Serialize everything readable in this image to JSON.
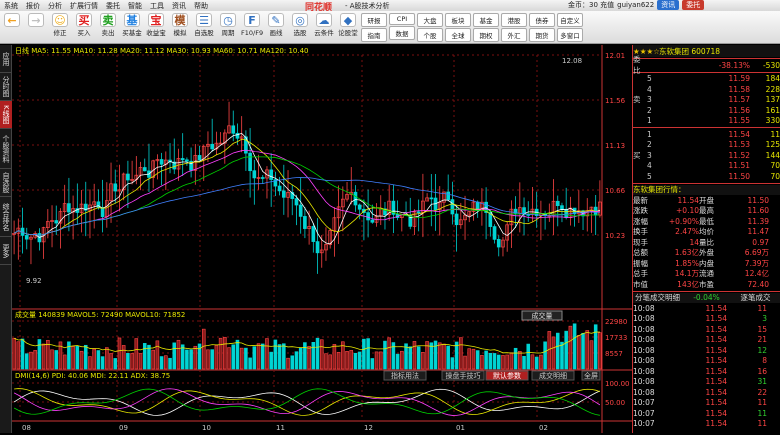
{
  "titlebar": {
    "menus": [
      "系统",
      "报价",
      "分析",
      "扩展行情",
      "委托",
      "智能",
      "工具",
      "资讯",
      "帮助"
    ],
    "logo": "同花顺",
    "title": "- A股技术分析",
    "account": "金币：30 充值",
    "user": "guiyan622",
    "btn1": "资讯",
    "btn2": "委托"
  },
  "toolbar": {
    "items": [
      {
        "label": "",
        "icon": "←",
        "color": "#f0a020"
      },
      {
        "label": "",
        "icon": "→",
        "color": "#c0c0c0"
      },
      {
        "label": "修正",
        "icon": "☺",
        "color": "#f0b020"
      },
      {
        "label": "买入",
        "icon": "买",
        "color": "#e02020"
      },
      {
        "label": "卖出",
        "icon": "卖",
        "color": "#20a020"
      },
      {
        "label": "买基金",
        "icon": "基",
        "color": "#2080e0"
      },
      {
        "label": "收益宝",
        "icon": "宝",
        "color": "#e02020"
      },
      {
        "label": "模拟",
        "icon": "模",
        "color": "#a05020"
      },
      {
        "label": "自选股",
        "icon": "☰",
        "color": "#3070c0"
      },
      {
        "label": "周期",
        "icon": "◷",
        "color": "#3070c0"
      },
      {
        "label": "F10/F9",
        "icon": "F",
        "color": "#3070c0"
      },
      {
        "label": "画线",
        "icon": "✎",
        "color": "#3070c0"
      },
      {
        "label": "选股",
        "icon": "◎",
        "color": "#3070c0"
      },
      {
        "label": "云条件",
        "icon": "☁",
        "color": "#3070c0"
      },
      {
        "label": "论股堂",
        "icon": "◆",
        "color": "#3070c0"
      }
    ],
    "pairs": [
      [
        "研报",
        "指南"
      ],
      [
        "CPI",
        "数据"
      ],
      [
        "大盘",
        "个股"
      ],
      [
        "板块",
        "全球"
      ],
      [
        "基金",
        "期权"
      ],
      [
        "港股",
        "外汇"
      ],
      [
        "债券",
        "期货"
      ],
      [
        "自定义",
        "多窗口"
      ]
    ]
  },
  "leftbar": {
    "tabs": [
      "应用",
      "分时图",
      "K线图",
      "个股资料",
      "自选股",
      "综合排名",
      "更多"
    ],
    "active": 2
  },
  "chart": {
    "header": "日线  MA5: 11.55  MA10: 11.28  MA20: 11.12  MA30: 10.93  MA60: 10.71  MA120: 10.40",
    "price_ticks": [
      "12.01",
      "11.56",
      "11.13",
      "10.66",
      "10.23"
    ],
    "high_label": "12.08",
    "low_label": "9.92",
    "vol_header": "成交量 140839  MAVOL5: 72490  MAVOL10: 71852",
    "vol_ticks": [
      "22980",
      "17733",
      "8557"
    ],
    "vol_button": "成交量",
    "ind_header": "DMI(14,6) PDI: 40.06  MDI: 22.11  ADX: 38.75",
    "ind_tabs": [
      "指标用法",
      "操盘手技巧",
      "默认参数",
      "成交明细",
      "全屏"
    ],
    "ind_tab_active": 2,
    "ind_ticks": [
      "100.00",
      "50.00"
    ],
    "dates": [
      "08",
      "09",
      "10",
      "11",
      "12",
      "01",
      "02"
    ]
  },
  "quote": {
    "title": "东软集团 600718",
    "ratio_label": "委比",
    "ratio": "-38.13%",
    "ratio_diff": "-530",
    "sell_label": "卖",
    "buy_label": "买",
    "sells": [
      [
        "5",
        "11.59",
        "184"
      ],
      [
        "4",
        "11.58",
        "228"
      ],
      [
        "3",
        "11.57",
        "137"
      ],
      [
        "2",
        "11.56",
        "161"
      ],
      [
        "1",
        "11.55",
        "330"
      ]
    ],
    "buys": [
      [
        "1",
        "11.54",
        "11"
      ],
      [
        "2",
        "11.53",
        "125"
      ],
      [
        "3",
        "11.52",
        "144"
      ],
      [
        "4",
        "11.51",
        "70"
      ],
      [
        "5",
        "11.50",
        "70"
      ]
    ],
    "info_title": "东软集团行情：",
    "info": [
      [
        "最新",
        "11.54",
        "开盘",
        "11.50"
      ],
      [
        "涨跌",
        "+0.10",
        "最高",
        "11.60"
      ],
      [
        "涨幅",
        "+0.90%",
        "最低",
        "11.39"
      ],
      [
        "换手",
        "2.47%",
        "均价",
        "11.47"
      ],
      [
        "现手",
        "14",
        "量比",
        "0.97"
      ],
      [
        "总额",
        "1.63亿",
        "外盘",
        "6.69万"
      ],
      [
        "振幅",
        "1.85%",
        "内盘",
        "7.39万"
      ],
      [
        "总手",
        "14.1万",
        "流通",
        "12.4亿"
      ],
      [
        "市值",
        "143亿",
        "市盈",
        "72.40"
      ]
    ],
    "ticks_header": [
      "分笔成交明细",
      "-0.04%",
      "逐笔成交"
    ],
    "ticks": [
      [
        "10:08",
        "11.54",
        "11"
      ],
      [
        "10:08",
        "11.54",
        "3"
      ],
      [
        "10:08",
        "11.54",
        "15"
      ],
      [
        "10:08",
        "11.54",
        "21"
      ],
      [
        "10:08",
        "11.54",
        "12"
      ],
      [
        "10:08",
        "11.54",
        "8"
      ],
      [
        "10:08",
        "11.54",
        "16"
      ],
      [
        "10:08",
        "11.54",
        "31"
      ],
      [
        "10:08",
        "11.54",
        "22"
      ],
      [
        "10:07",
        "11.54",
        "11"
      ],
      [
        "10:07",
        "11.54",
        "11"
      ],
      [
        "10:07",
        "11.54",
        "11"
      ]
    ]
  },
  "colors": {
    "up": "#ff4545",
    "down": "#00d4d4",
    "grid": "#7a1010",
    "accent": "#e02020"
  }
}
